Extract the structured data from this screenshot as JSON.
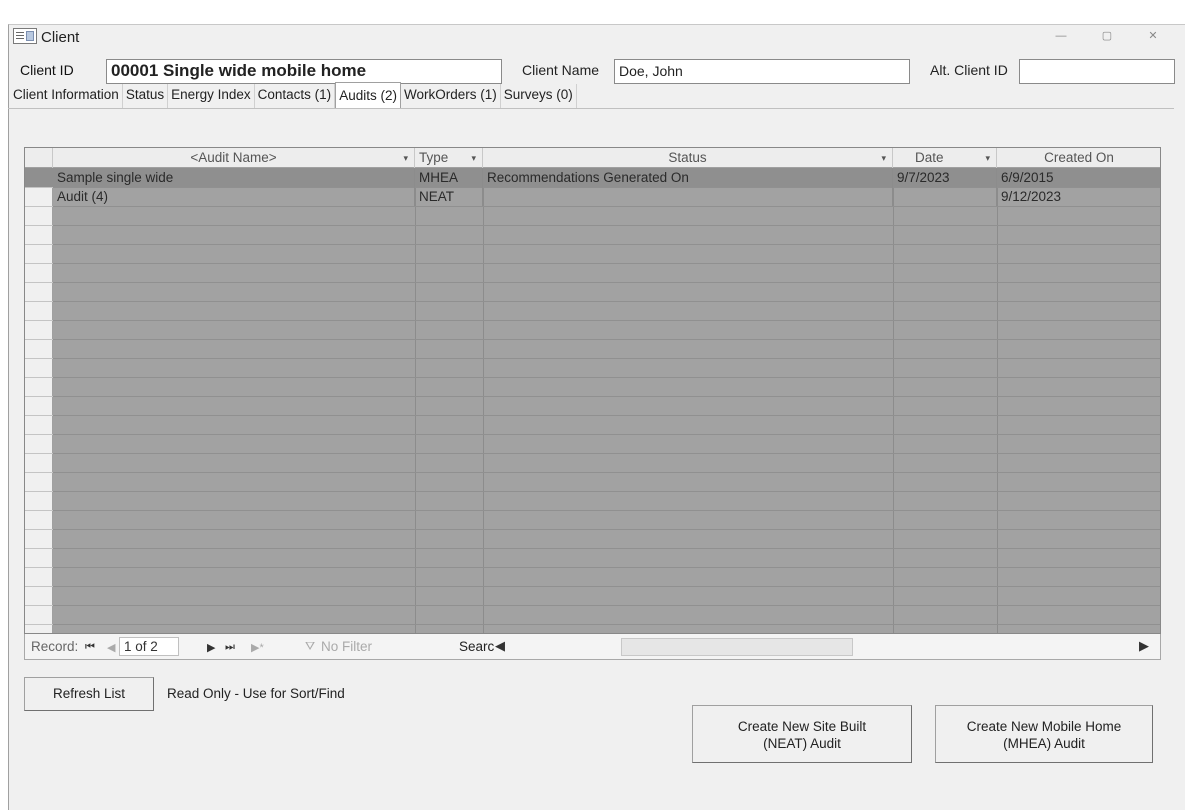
{
  "window": {
    "title": "Client",
    "controls": [
      "—",
      "▢",
      "✕"
    ]
  },
  "header": {
    "client_id_label": "Client ID",
    "client_id_value": "00001 Single wide mobile home",
    "client_name_label": "Client Name",
    "client_name_value": "Doe, John",
    "alt_client_id_label": "Alt. Client ID",
    "alt_client_id_value": ""
  },
  "tabs": [
    {
      "label": "Client Information"
    },
    {
      "label": "Status"
    },
    {
      "label": "Energy Index"
    },
    {
      "label": "Contacts (1)"
    },
    {
      "label": "Audits (2)",
      "active": true
    },
    {
      "label": "WorkOrders (1)"
    },
    {
      "label": "Surveys (0)"
    }
  ],
  "grid": {
    "columns": [
      "<Audit Name>",
      "Type",
      "Status",
      "Date",
      "Created On"
    ],
    "rows": [
      {
        "audit_name": "Sample single wide",
        "type": "MHEA",
        "status": "Recommendations Generated On",
        "date": "9/7/2023",
        "created_on": "6/9/2015"
      },
      {
        "audit_name": "Audit (4)",
        "type": "NEAT",
        "status": "",
        "date": "",
        "created_on": "9/12/2023"
      }
    ]
  },
  "navigation": {
    "record_label": "Record:",
    "position": "1 of 2",
    "filter_label": "No Filter",
    "search_label": "Searc"
  },
  "actions": {
    "refresh_label": "Refresh List",
    "readonly_note": "Read Only - Use for Sort/Find",
    "create_neat_line1": "Create New Site Built",
    "create_neat_line2": "(NEAT) Audit",
    "create_mhea_line1": "Create New Mobile Home",
    "create_mhea_line2": "(MHEA) Audit"
  },
  "colors": {
    "grid_bg": "#a2a2a2",
    "selected_row": "#8f8f8f",
    "window_bg": "#f0f0f0"
  }
}
